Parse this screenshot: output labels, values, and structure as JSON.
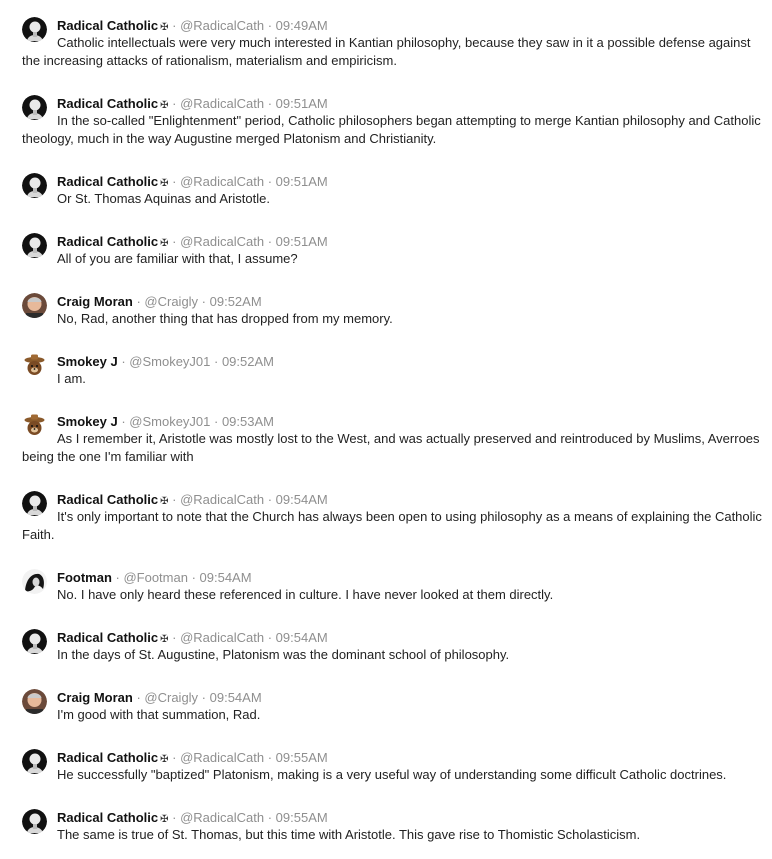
{
  "messages": [
    {
      "author": "Radical Catholic",
      "badge": "✠",
      "handle": "@RadicalCath",
      "time": "09:49AM",
      "avatar": "radical",
      "text": "Catholic intellectuals were very much interested in Kantian philosophy, because they saw in it a possible defense against the increasing attacks of rationalism, materialism and empiricism."
    },
    {
      "author": "Radical Catholic",
      "badge": "✠",
      "handle": "@RadicalCath",
      "time": "09:51AM",
      "avatar": "radical",
      "text": "In the so-called \"Enlightenment\" period, Catholic philosophers began attempting to merge Kantian philosophy and Catholic theology, much in the way Augustine merged Platonism and Christianity."
    },
    {
      "author": "Radical Catholic",
      "badge": "✠",
      "handle": "@RadicalCath",
      "time": "09:51AM",
      "avatar": "radical",
      "text": "Or St. Thomas Aquinas and Aristotle."
    },
    {
      "author": "Radical Catholic",
      "badge": "✠",
      "handle": "@RadicalCath",
      "time": "09:51AM",
      "avatar": "radical",
      "text": "All of you are familiar with that, I assume?"
    },
    {
      "author": "Craig Moran",
      "badge": "",
      "handle": "@Craigly",
      "time": "09:52AM",
      "avatar": "craig",
      "text": "No, Rad, another thing that has dropped from my memory."
    },
    {
      "author": "Smokey J",
      "badge": "",
      "handle": "@SmokeyJ01",
      "time": "09:52AM",
      "avatar": "smokey",
      "text": "I am."
    },
    {
      "author": "Smokey J",
      "badge": "",
      "handle": "@SmokeyJ01",
      "time": "09:53AM",
      "avatar": "smokey",
      "text": "As I remember it, Aristotle was mostly lost to the West, and was actually preserved and reintroduced by Muslims, Averroes being the one I'm familiar with"
    },
    {
      "author": "Radical Catholic",
      "badge": "✠",
      "handle": "@RadicalCath",
      "time": "09:54AM",
      "avatar": "radical",
      "text": "It's only important to note that the Church has always been open to using philosophy as a means of explaining the Catholic Faith."
    },
    {
      "author": "Footman",
      "badge": "",
      "handle": "@Footman",
      "time": "09:54AM",
      "avatar": "footman",
      "text": "No. I have only heard these referenced in culture. I have never looked at them directly."
    },
    {
      "author": "Radical Catholic",
      "badge": "✠",
      "handle": "@RadicalCath",
      "time": "09:54AM",
      "avatar": "radical",
      "text": "In the days of St. Augustine, Platonism was the dominant school of philosophy."
    },
    {
      "author": "Craig Moran",
      "badge": "",
      "handle": "@Craigly",
      "time": "09:54AM",
      "avatar": "craig",
      "text": "I'm good with that summation, Rad."
    },
    {
      "author": "Radical Catholic",
      "badge": "✠",
      "handle": "@RadicalCath",
      "time": "09:55AM",
      "avatar": "radical",
      "text": "He successfully \"baptized\" Platonism, making is a very useful way of understanding some difficult Catholic doctrines."
    },
    {
      "author": "Radical Catholic",
      "badge": "✠",
      "handle": "@RadicalCath",
      "time": "09:55AM",
      "avatar": "radical",
      "text": "The same is true of St. Thomas, but this time with Aristotle. This gave rise to Thomistic Scholasticism."
    }
  ]
}
